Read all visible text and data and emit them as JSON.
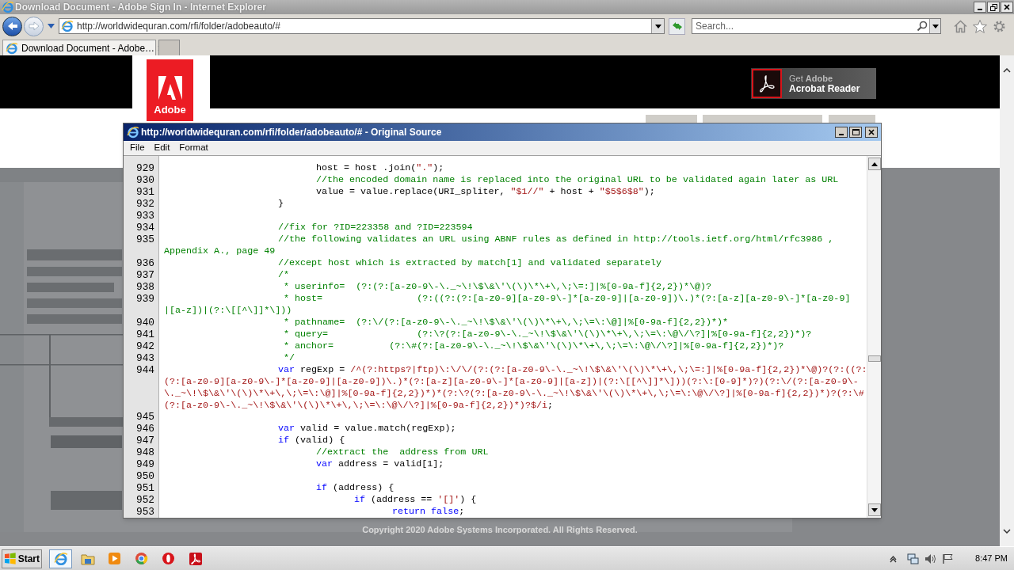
{
  "browser": {
    "title": "Download Document - Adobe Sign In - Internet Explorer",
    "address": "http://worldwidequran.com/rfi/folder/adobeauto/#",
    "search_placeholder": "Search...",
    "tabs": [
      {
        "label": "Download Document - Adobe…",
        "selected": true
      }
    ]
  },
  "page": {
    "logo_text": "Adobe",
    "reader_button": {
      "line_1": "Get **Adobe**",
      "line_2": "Acrobat Reader"
    },
    "footer": "Copyright 2020 Adobe Systems Incorporated. All Rights Reserved."
  },
  "source_window": {
    "title": "http://worldwidequran.com/rfi/folder/adobeauto/# - Original Source",
    "menu": [
      "File",
      "Edit",
      "Format"
    ],
    "rows": [
      {
        "number": "929",
        "segments": [
          {
            "kind": "plain",
            "text": "\t\t\t\thost = host .join("
          },
          {
            "kind": "string",
            "text": "\".\""
          },
          {
            "kind": "plain",
            "text": ");"
          }
        ]
      },
      {
        "number": "930",
        "segments": [
          {
            "kind": "comment",
            "text": "\t\t\t\t//the encoded domain name is replaced into the original URL to be validated again later as URL"
          }
        ]
      },
      {
        "number": "931",
        "segments": [
          {
            "kind": "plain",
            "text": "\t\t\t\tvalue = value.replace(URI_spliter, "
          },
          {
            "kind": "string",
            "text": "\"$1//\""
          },
          {
            "kind": "plain",
            "text": " + host + "
          },
          {
            "kind": "string",
            "text": "\"$5$6$8\""
          },
          {
            "kind": "plain",
            "text": ");"
          }
        ]
      },
      {
        "number": "932",
        "segments": [
          {
            "kind": "plain",
            "text": "\t\t\t}"
          }
        ]
      },
      {
        "number": "933"
      },
      {
        "number": "934",
        "segments": [
          {
            "kind": "comment",
            "text": "\t\t\t//fix for ?ID=223358 and ?ID=223594"
          }
        ]
      },
      {
        "number": "935",
        "segments": [
          {
            "kind": "comment",
            "text": "\t\t\t//the following validates an URL using ABNF rules as defined in http://tools.ietf.org/html/rfc3986 ,"
          }
        ]
      },
      {
        "segments": [
          {
            "kind": "comment",
            "text": "Appendix A., page 49"
          }
        ]
      },
      {
        "number": "936",
        "segments": [
          {
            "kind": "comment",
            "text": "\t\t\t//except host which is extracted by match[1] and validated separately"
          }
        ]
      },
      {
        "number": "937",
        "segments": [
          {
            "kind": "comment",
            "text": "\t\t\t/*"
          }
        ]
      },
      {
        "number": "938",
        "segments": [
          {
            "kind": "comment",
            "text": "\t\t\t * userinfo=  (?:(?:[a-z0-9\\-\\._~\\!\\$\\&\\'\\(\\)\\*\\+\\,\\;\\=:]|%[0-9a-f]{2,2})*\\@)?"
          }
        ]
      },
      {
        "number": "939",
        "segments": [
          {
            "kind": "comment",
            "text": "\t\t\t * host=                 (?:((?:(?:[a-z0-9][a-z0-9\\-]*[a-z0-9]|[a-z0-9])\\.)*(?:[a-z][a-z0-9\\-]*[a-z0-9]"
          }
        ]
      },
      {
        "segments": [
          {
            "kind": "comment",
            "text": "|[a-z])|(?:\\[[^\\]]*\\]))"
          }
        ]
      },
      {
        "number": "940",
        "segments": [
          {
            "kind": "comment",
            "text": "\t\t\t * pathname=  (?:\\/(?:[a-z0-9\\-\\._~\\!\\$\\&\\'\\(\\)\\*\\+\\,\\;\\=\\:\\@]|%[0-9a-f]{2,2})*)*"
          }
        ]
      },
      {
        "number": "941",
        "segments": [
          {
            "kind": "comment",
            "text": "\t\t\t * query=                (?:\\?(?:[a-z0-9\\-\\._~\\!\\$\\&\\'\\(\\)\\*\\+\\,\\;\\=\\:\\@\\/\\?]|%[0-9a-f]{2,2})*)?"
          }
        ]
      },
      {
        "number": "942",
        "segments": [
          {
            "kind": "comment",
            "text": "\t\t\t * anchor=          (?:\\#(?:[a-z0-9\\-\\._~\\!\\$\\&\\'\\(\\)\\*\\+\\,\\;\\=\\:\\@\\/\\?]|%[0-9a-f]{2,2})*)?"
          }
        ]
      },
      {
        "number": "943",
        "segments": [
          {
            "kind": "comment",
            "text": "\t\t\t */"
          }
        ]
      },
      {
        "number": "944",
        "segments": [
          {
            "kind": "keyword",
            "text": "\t\t\tvar"
          },
          {
            "kind": "plain",
            "text": " regExp = "
          },
          {
            "kind": "string",
            "text": "/^(?:https?|ftp)\\:\\/\\/(?:(?:[a-z0-9\\-\\._~\\!\\$\\&\\'\\(\\)\\*\\+\\,\\;\\=:]|%[0-9a-f]{2,2})*\\@)?(?:((?:"
          }
        ]
      },
      {
        "segments": [
          {
            "kind": "string",
            "text": "(?:[a-z0-9][a-z0-9\\-]*[a-z0-9]|[a-z0-9])\\.)*(?:[a-z][a-z0-9\\-]*[a-z0-9]|[a-z])|(?:\\[[^\\]]*\\]))(?:\\:[0-9]*)?)(?:\\/(?:[a-z0-9\\-"
          }
        ]
      },
      {
        "segments": [
          {
            "kind": "string",
            "text": "\\._~\\!\\$\\&\\'\\(\\)\\*\\+\\,\\;\\=\\:\\@]|%[0-9a-f]{2,2})*)*(?:\\?(?:[a-z0-9\\-\\._~\\!\\$\\&\\'\\(\\)\\*\\+\\,\\;\\=\\:\\@\\/\\?]|%[0-9a-f]{2,2})*)?(?:\\#"
          }
        ]
      },
      {
        "segments": [
          {
            "kind": "string",
            "text": "(?:[a-z0-9\\-\\._~\\!\\$\\&\\'\\(\\)\\*\\+\\,\\;\\=\\:\\@\\/\\?]|%[0-9a-f]{2,2})*)?$/i"
          },
          {
            "kind": "plain",
            "text": ";"
          }
        ]
      },
      {
        "number": "945"
      },
      {
        "number": "946",
        "segments": [
          {
            "kind": "keyword",
            "text": "\t\t\tvar"
          },
          {
            "kind": "plain",
            "text": " valid = value.match(regExp);"
          }
        ]
      },
      {
        "number": "947",
        "segments": [
          {
            "kind": "keyword",
            "text": "\t\t\tif"
          },
          {
            "kind": "plain",
            "text": " (valid) {"
          }
        ]
      },
      {
        "number": "948",
        "segments": [
          {
            "kind": "comment",
            "text": "\t\t\t\t//extract the  address from URL"
          }
        ]
      },
      {
        "number": "949",
        "segments": [
          {
            "kind": "keyword",
            "text": "\t\t\t\tvar"
          },
          {
            "kind": "plain",
            "text": " address = valid[1];"
          }
        ]
      },
      {
        "number": "950"
      },
      {
        "number": "951",
        "segments": [
          {
            "kind": "keyword",
            "text": "\t\t\t\tif"
          },
          {
            "kind": "plain",
            "text": " (address) {"
          }
        ]
      },
      {
        "number": "952",
        "segments": [
          {
            "kind": "keyword",
            "text": "\t\t\t\t\tif"
          },
          {
            "kind": "plain",
            "text": " (address == "
          },
          {
            "kind": "string",
            "text": "'[]'"
          },
          {
            "kind": "plain",
            "text": ") {"
          }
        ]
      },
      {
        "number": "953",
        "segments": [
          {
            "kind": "keyword",
            "text": "\t\t\t\t\t\treturn false"
          },
          {
            "kind": "plain",
            "text": ";"
          }
        ]
      }
    ]
  },
  "taskbar": {
    "start": "Start",
    "apps": [
      {
        "kind": "ie",
        "selected": true
      },
      {
        "kind": "folder",
        "selected": false
      },
      {
        "kind": "media",
        "selected": false
      },
      {
        "kind": "chrome",
        "selected": false
      },
      {
        "kind": "opera",
        "selected": false
      },
      {
        "kind": "pdf",
        "selected": false
      }
    ],
    "clock": "8:47 PM"
  }
}
